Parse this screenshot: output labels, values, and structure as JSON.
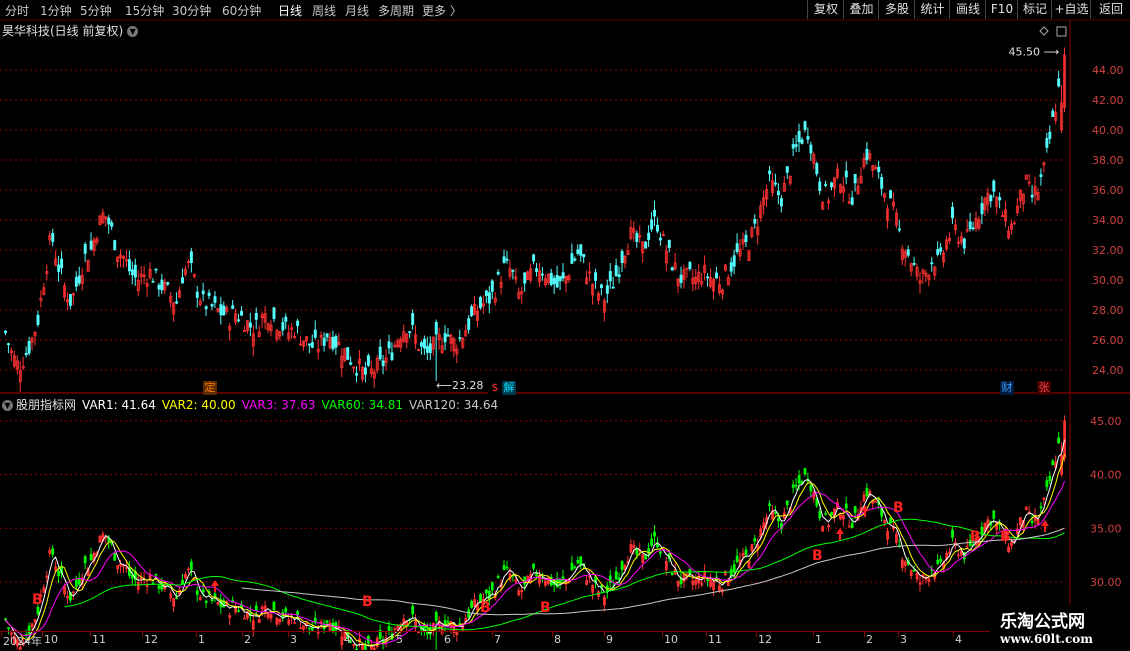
{
  "toolbar": {
    "periods": [
      "分时",
      "1分钟",
      "5分钟",
      "15分钟",
      "30分钟",
      "60分钟",
      "日线",
      "周线",
      "月线",
      "多周期",
      "更多 〉"
    ],
    "active_period": "日线",
    "right_buttons": [
      "复权",
      "叠加",
      "多股",
      "统计",
      "画线",
      "F10",
      "标记",
      "+自选",
      "返回"
    ]
  },
  "stock": {
    "title": "昊华科技(日线 前复权)"
  },
  "price_chart": {
    "yaxis_ticks": [
      "44.00",
      "42.00",
      "40.00",
      "38.00",
      "36.00",
      "34.00",
      "32.00",
      "30.00",
      "28.00",
      "26.00",
      "24.00"
    ],
    "high_label": "45.50",
    "low_label": "23.28",
    "events": [
      {
        "text": "定",
        "color": "#ff7f00",
        "bg": "#5a2a00"
      },
      {
        "text": "$",
        "color": "#ff3030",
        "bg": "#000000"
      },
      {
        "text": "解",
        "color": "#00e0ff",
        "bg": "#003a4a"
      },
      {
        "text": "财",
        "color": "#3fa0ff",
        "bg": "#001a40"
      },
      {
        "text": "张",
        "color": "#ff4040",
        "bg": "#400000"
      }
    ]
  },
  "indicator": {
    "name": "股朋指标网",
    "vars": [
      {
        "label": "VAR1: 41.64",
        "color": "#ffffff"
      },
      {
        "label": "VAR2: 40.00",
        "color": "#ffff00"
      },
      {
        "label": "VAR3: 37.63",
        "color": "#ff00ff"
      },
      {
        "label": "VAR60: 34.81",
        "color": "#00ff00"
      },
      {
        "label": "VAR120: 34.64",
        "color": "#c8c8c8"
      }
    ],
    "yaxis_ticks": [
      "45.00",
      "40.00",
      "35.00",
      "30.00"
    ],
    "signals": [
      "B",
      "B",
      "B",
      "B",
      "B",
      "B",
      "B",
      "B"
    ]
  },
  "x_axis": {
    "labels": [
      "2024年",
      "10",
      "11",
      "12",
      "1",
      "2",
      "3",
      "4",
      "5",
      "6",
      "7",
      "8",
      "9",
      "10",
      "11",
      "12",
      "1",
      "2",
      "3",
      "4"
    ]
  },
  "watermark": {
    "line1": "乐淘公式网",
    "line2": "www.60lt.com"
  },
  "colors": {
    "up": "#ff3232",
    "down": "#54fcfc",
    "ind_up": "#ff3232",
    "ind_down": "#00ff00",
    "grid": "#8b0000",
    "accent": "#ffffff"
  },
  "chart_data": {
    "type": "candlestick",
    "title": "昊华科技(日线 前复权)",
    "ylim": [
      23,
      46
    ],
    "x_start": "2024-09",
    "x_end": "2026-04",
    "high": 45.5,
    "low": 23.28,
    "series": [
      {
        "name": "close",
        "values": [
          26.5,
          25.0,
          24.2,
          25.0,
          26.0,
          27.5,
          30.5,
          33.0,
          31.0,
          29.5,
          28.5,
          30.0,
          31.5,
          32.0,
          33.5,
          34.5,
          33.5,
          32.0,
          31.5,
          30.5,
          30.0,
          30.3,
          30.5,
          30.0,
          29.5,
          29.0,
          28.5,
          30.5,
          31.0,
          29.5,
          28.5,
          28.3,
          28.0,
          27.8,
          27.5,
          27.8,
          27.5,
          27.0,
          26.8,
          27.5,
          27.8,
          27.3,
          27.0,
          26.5,
          26.8,
          26.2,
          25.8,
          25.5,
          25.8,
          26.5,
          26.0,
          25.5,
          25.0,
          24.5,
          24.0,
          23.6,
          24.0,
          24.3,
          24.8,
          25.5,
          26.5,
          27.0,
          26.5,
          25.5,
          25.0,
          25.5,
          26.0,
          26.5,
          25.8,
          26.0,
          26.8,
          27.5,
          28.2,
          28.5,
          29.0,
          30.0,
          31.0,
          30.5,
          29.0,
          29.5,
          30.5,
          31.0,
          30.5,
          30.0,
          29.5,
          30.0,
          31.0,
          31.8,
          31.0,
          30.0,
          29.2,
          28.8,
          29.5,
          30.5,
          32.0,
          33.0,
          32.5,
          32.0,
          33.5,
          34.0,
          32.5,
          31.5,
          30.5,
          30.0,
          30.2,
          30.0,
          30.5,
          30.2,
          30.0,
          30.0,
          30.8,
          31.5,
          32.0,
          32.5,
          33.5,
          35.0,
          36.5,
          36.0,
          35.5,
          37.0,
          38.5,
          39.5,
          40.0,
          38.0,
          36.0,
          35.5,
          36.5,
          37.0,
          36.0,
          35.5,
          37.5,
          38.5,
          37.5,
          36.5,
          35.5,
          34.5,
          33.0,
          32.0,
          31.0,
          30.0,
          30.5,
          31.5,
          31.0,
          32.5,
          33.5,
          33.0,
          32.5,
          33.5,
          34.5,
          35.5,
          36.0,
          35.0,
          34.0,
          33.5,
          35.0,
          36.5,
          35.5,
          36.0,
          37.5,
          40.0,
          42.5,
          44.5
        ]
      }
    ]
  }
}
